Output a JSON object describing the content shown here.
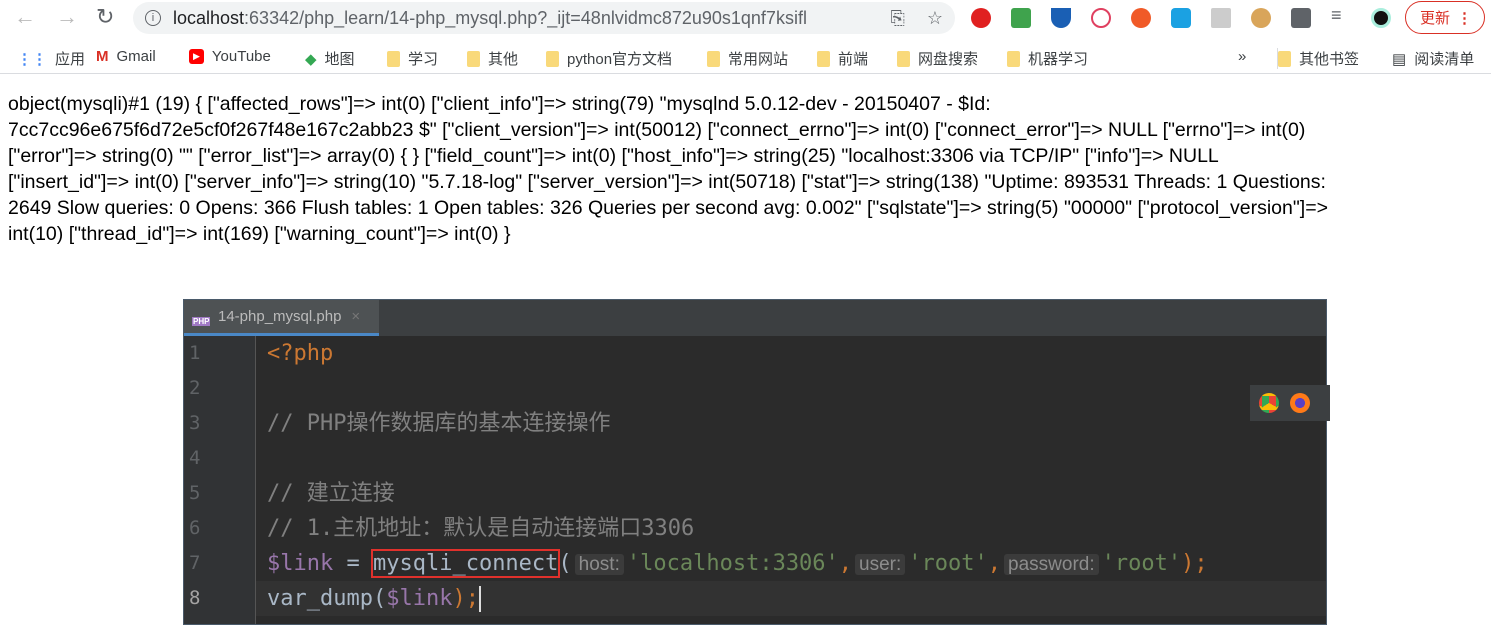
{
  "browser": {
    "url_host": "localhost",
    "url_rest": ":63342/php_learn/14-php_mysql.php?_ijt=48nlvidmc872u90s1qnf7ksifl",
    "update_label": "更新",
    "bookmarks": [
      "应用",
      "Gmail",
      "YouTube",
      "地图",
      "学习",
      "其他",
      "python官方文档",
      "常用网站",
      "前端",
      "网盘搜索",
      "机器学习"
    ],
    "overflow": "»",
    "other_bookmarks": "其他书签",
    "reading_list": "阅读清单"
  },
  "dump_lines": [
    "object(mysqli)#1 (19) { [\"affected_rows\"]=> int(0) [\"client_info\"]=> string(79) \"mysqlnd 5.0.12-dev - 20150407 - $Id:",
    "7cc7cc96e675f6d72e5cf0f267f48e167c2abb23 $\" [\"client_version\"]=> int(50012) [\"connect_errno\"]=> int(0) [\"connect_error\"]=> NULL [\"errno\"]=> int(0)",
    "[\"error\"]=> string(0) \"\" [\"error_list\"]=> array(0) { } [\"field_count\"]=> int(0) [\"host_info\"]=> string(25) \"localhost:3306 via TCP/IP\" [\"info\"]=> NULL",
    "[\"insert_id\"]=> int(0) [\"server_info\"]=> string(10) \"5.7.18-log\" [\"server_version\"]=> int(50718) [\"stat\"]=> string(138) \"Uptime: 893531 Threads: 1 Questions:",
    "2649 Slow queries: 0 Opens: 366 Flush tables: 1 Open tables: 326 Queries per second avg: 0.002\" [\"sqlstate\"]=> string(5) \"00000\" [\"protocol_version\"]=>",
    "int(10) [\"thread_id\"]=> int(169) [\"warning_count\"]=> int(0) }"
  ],
  "editor": {
    "tab_label": "14-php_mysql.php",
    "line_numbers": [
      "1",
      "2",
      "3",
      "4",
      "5",
      "6",
      "7",
      "8"
    ],
    "lines": [
      [
        {
          "t": "<?php",
          "c": "#cc7832"
        }
      ],
      [],
      [
        {
          "t": "// PHP操作数据库的基本连接操作",
          "c": "#808080"
        }
      ],
      [],
      [
        {
          "t": "// 建立连接",
          "c": "#808080"
        }
      ],
      [
        {
          "t": "// 1.主机地址：默认是自动连接端口3306",
          "c": "#808080"
        }
      ],
      [
        {
          "t": "$link",
          "c": "#9876aa"
        },
        {
          "t": " = ",
          "c": "#a9b7c6"
        },
        {
          "t": "mysqli_connect",
          "c": "#a9b7c6",
          "box": true
        },
        {
          "t": "(",
          "c": "#a9b7c6"
        },
        {
          "t": "host:",
          "hint": true
        },
        {
          "t": "'localhost:3306'",
          "c": "#6a8759"
        },
        {
          "t": ",",
          "c": "#cc7832"
        },
        {
          "t": "user:",
          "hint": true
        },
        {
          "t": "'root'",
          "c": "#6a8759"
        },
        {
          "t": ",",
          "c": "#cc7832"
        },
        {
          "t": "password:",
          "hint": true
        },
        {
          "t": "'root'",
          "c": "#6a8759"
        },
        {
          "t": ");",
          "c": "#cc7832"
        }
      ],
      [
        {
          "t": "var_dump(",
          "c": "#a9b7c6"
        },
        {
          "t": "$link",
          "c": "#9876aa"
        },
        {
          "t": ");",
          "c": "#cc7832"
        }
      ]
    ],
    "current_line": 8
  }
}
